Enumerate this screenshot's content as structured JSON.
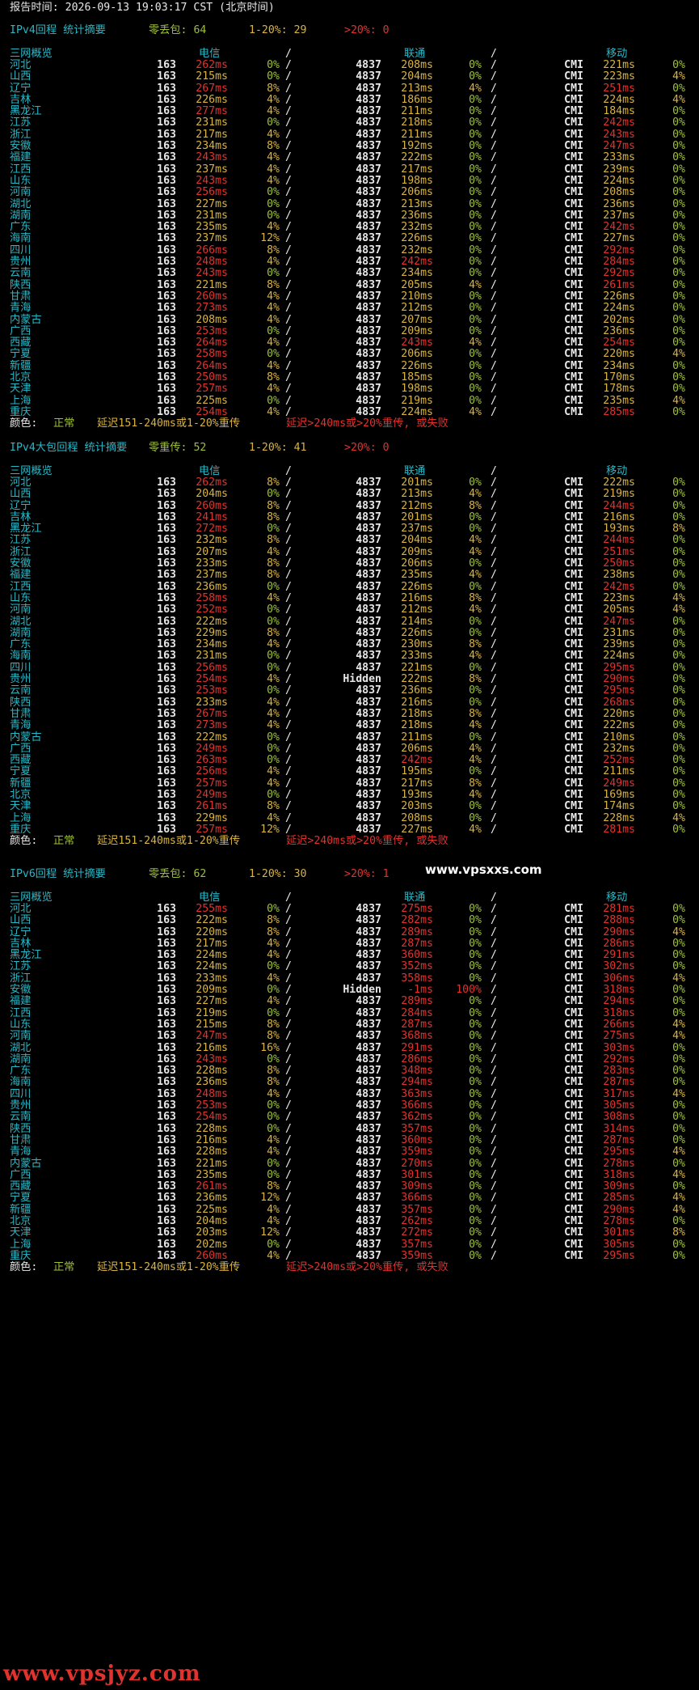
{
  "report_line": "报告时间: 2026-09-13 19:03:17 CST (北京时间)",
  "colors": {
    "ok": "#9fc03a",
    "warn": "#d9b441",
    "bad": "#e0332f",
    "cyan": "#29b7c6"
  },
  "legend": {
    "label": "颜色:",
    "ok": "正常",
    "warn": "延迟151-240ms或1-20%重传",
    "bad": "延迟>240ms或>20%重传, 或失败"
  },
  "columns": {
    "overview": "三网概览",
    "telecom": "电信",
    "unicom": "联通",
    "mobile": "移动"
  },
  "sections": [
    {
      "title": "IPv4回程 统计摘要",
      "summary": {
        "zero_label": "零丢包: 64",
        "mid_label": "1-20%: 29",
        "high_label": ">20%: 0"
      },
      "rows": [
        [
          "河北",
          "163",
          "262ms",
          "0%",
          "4837",
          "208ms",
          "0%",
          "CMI",
          "221ms",
          "0%"
        ],
        [
          "山西",
          "163",
          "215ms",
          "0%",
          "4837",
          "204ms",
          "0%",
          "CMI",
          "223ms",
          "4%"
        ],
        [
          "辽宁",
          "163",
          "267ms",
          "8%",
          "4837",
          "213ms",
          "4%",
          "CMI",
          "251ms",
          "0%"
        ],
        [
          "吉林",
          "163",
          "226ms",
          "4%",
          "4837",
          "186ms",
          "0%",
          "CMI",
          "224ms",
          "4%"
        ],
        [
          "黑龙江",
          "163",
          "277ms",
          "4%",
          "4837",
          "211ms",
          "0%",
          "CMI",
          "184ms",
          "0%"
        ],
        [
          "江苏",
          "163",
          "231ms",
          "0%",
          "4837",
          "218ms",
          "0%",
          "CMI",
          "242ms",
          "0%"
        ],
        [
          "浙江",
          "163",
          "217ms",
          "4%",
          "4837",
          "211ms",
          "0%",
          "CMI",
          "243ms",
          "0%"
        ],
        [
          "安徽",
          "163",
          "234ms",
          "8%",
          "4837",
          "192ms",
          "0%",
          "CMI",
          "247ms",
          "0%"
        ],
        [
          "福建",
          "163",
          "243ms",
          "4%",
          "4837",
          "222ms",
          "0%",
          "CMI",
          "233ms",
          "0%"
        ],
        [
          "江西",
          "163",
          "237ms",
          "4%",
          "4837",
          "217ms",
          "0%",
          "CMI",
          "239ms",
          "0%"
        ],
        [
          "山东",
          "163",
          "243ms",
          "4%",
          "4837",
          "198ms",
          "0%",
          "CMI",
          "224ms",
          "0%"
        ],
        [
          "河南",
          "163",
          "256ms",
          "0%",
          "4837",
          "206ms",
          "0%",
          "CMI",
          "208ms",
          "0%"
        ],
        [
          "湖北",
          "163",
          "227ms",
          "0%",
          "4837",
          "213ms",
          "0%",
          "CMI",
          "236ms",
          "0%"
        ],
        [
          "湖南",
          "163",
          "231ms",
          "0%",
          "4837",
          "236ms",
          "0%",
          "CMI",
          "237ms",
          "0%"
        ],
        [
          "广东",
          "163",
          "235ms",
          "4%",
          "4837",
          "232ms",
          "0%",
          "CMI",
          "242ms",
          "0%"
        ],
        [
          "海南",
          "163",
          "237ms",
          "12%",
          "4837",
          "226ms",
          "0%",
          "CMI",
          "227ms",
          "0%"
        ],
        [
          "四川",
          "163",
          "266ms",
          "8%",
          "4837",
          "232ms",
          "0%",
          "CMI",
          "292ms",
          "0%"
        ],
        [
          "贵州",
          "163",
          "248ms",
          "4%",
          "4837",
          "242ms",
          "0%",
          "CMI",
          "284ms",
          "0%"
        ],
        [
          "云南",
          "163",
          "243ms",
          "0%",
          "4837",
          "234ms",
          "0%",
          "CMI",
          "292ms",
          "0%"
        ],
        [
          "陕西",
          "163",
          "221ms",
          "8%",
          "4837",
          "205ms",
          "4%",
          "CMI",
          "261ms",
          "0%"
        ],
        [
          "甘肃",
          "163",
          "260ms",
          "4%",
          "4837",
          "210ms",
          "0%",
          "CMI",
          "226ms",
          "0%"
        ],
        [
          "青海",
          "163",
          "273ms",
          "4%",
          "4837",
          "212ms",
          "0%",
          "CMI",
          "224ms",
          "0%"
        ],
        [
          "内蒙古",
          "163",
          "208ms",
          "4%",
          "4837",
          "207ms",
          "0%",
          "CMI",
          "202ms",
          "0%"
        ],
        [
          "广西",
          "163",
          "253ms",
          "0%",
          "4837",
          "209ms",
          "0%",
          "CMI",
          "236ms",
          "0%"
        ],
        [
          "西藏",
          "163",
          "264ms",
          "4%",
          "4837",
          "243ms",
          "4%",
          "CMI",
          "254ms",
          "0%"
        ],
        [
          "宁夏",
          "163",
          "258ms",
          "0%",
          "4837",
          "206ms",
          "0%",
          "CMI",
          "220ms",
          "4%"
        ],
        [
          "新疆",
          "163",
          "264ms",
          "4%",
          "4837",
          "226ms",
          "0%",
          "CMI",
          "234ms",
          "0%"
        ],
        [
          "北京",
          "163",
          "250ms",
          "8%",
          "4837",
          "185ms",
          "0%",
          "CMI",
          "170ms",
          "0%"
        ],
        [
          "天津",
          "163",
          "257ms",
          "4%",
          "4837",
          "198ms",
          "0%",
          "CMI",
          "178ms",
          "0%"
        ],
        [
          "上海",
          "163",
          "225ms",
          "0%",
          "4837",
          "219ms",
          "0%",
          "CMI",
          "235ms",
          "4%"
        ],
        [
          "重庆",
          "163",
          "254ms",
          "4%",
          "4837",
          "224ms",
          "4%",
          "CMI",
          "285ms",
          "0%"
        ]
      ]
    },
    {
      "title": "IPv4大包回程 统计摘要",
      "summary": {
        "zero_label": "零重传: 52",
        "mid_label": "1-20%: 41",
        "high_label": ">20%: 0"
      },
      "rows": [
        [
          "河北",
          "163",
          "262ms",
          "8%",
          "4837",
          "201ms",
          "0%",
          "CMI",
          "222ms",
          "0%"
        ],
        [
          "山西",
          "163",
          "204ms",
          "0%",
          "4837",
          "213ms",
          "4%",
          "CMI",
          "219ms",
          "0%"
        ],
        [
          "辽宁",
          "163",
          "260ms",
          "8%",
          "4837",
          "212ms",
          "8%",
          "CMI",
          "244ms",
          "0%"
        ],
        [
          "吉林",
          "163",
          "241ms",
          "8%",
          "4837",
          "201ms",
          "0%",
          "CMI",
          "216ms",
          "0%"
        ],
        [
          "黑龙江",
          "163",
          "272ms",
          "0%",
          "4837",
          "237ms",
          "0%",
          "CMI",
          "193ms",
          "8%"
        ],
        [
          "江苏",
          "163",
          "232ms",
          "8%",
          "4837",
          "204ms",
          "4%",
          "CMI",
          "244ms",
          "0%"
        ],
        [
          "浙江",
          "163",
          "207ms",
          "4%",
          "4837",
          "209ms",
          "4%",
          "CMI",
          "251ms",
          "0%"
        ],
        [
          "安徽",
          "163",
          "233ms",
          "8%",
          "4837",
          "206ms",
          "0%",
          "CMI",
          "250ms",
          "0%"
        ],
        [
          "福建",
          "163",
          "237ms",
          "8%",
          "4837",
          "235ms",
          "4%",
          "CMI",
          "238ms",
          "0%"
        ],
        [
          "江西",
          "163",
          "236ms",
          "0%",
          "4837",
          "226ms",
          "0%",
          "CMI",
          "242ms",
          "0%"
        ],
        [
          "山东",
          "163",
          "258ms",
          "4%",
          "4837",
          "216ms",
          "8%",
          "CMI",
          "223ms",
          "4%"
        ],
        [
          "河南",
          "163",
          "252ms",
          "0%",
          "4837",
          "212ms",
          "4%",
          "CMI",
          "205ms",
          "4%"
        ],
        [
          "湖北",
          "163",
          "222ms",
          "0%",
          "4837",
          "214ms",
          "0%",
          "CMI",
          "247ms",
          "0%"
        ],
        [
          "湖南",
          "163",
          "229ms",
          "8%",
          "4837",
          "226ms",
          "0%",
          "CMI",
          "231ms",
          "0%"
        ],
        [
          "广东",
          "163",
          "234ms",
          "4%",
          "4837",
          "230ms",
          "8%",
          "CMI",
          "239ms",
          "0%"
        ],
        [
          "海南",
          "163",
          "231ms",
          "0%",
          "4837",
          "233ms",
          "4%",
          "CMI",
          "224ms",
          "0%"
        ],
        [
          "四川",
          "163",
          "256ms",
          "0%",
          "4837",
          "221ms",
          "0%",
          "CMI",
          "295ms",
          "0%"
        ],
        [
          "贵州",
          "163",
          "254ms",
          "4%",
          "Hidden",
          "222ms",
          "8%",
          "CMI",
          "290ms",
          "0%"
        ],
        [
          "云南",
          "163",
          "253ms",
          "0%",
          "4837",
          "236ms",
          "0%",
          "CMI",
          "295ms",
          "0%"
        ],
        [
          "陕西",
          "163",
          "233ms",
          "4%",
          "4837",
          "216ms",
          "0%",
          "CMI",
          "268ms",
          "0%"
        ],
        [
          "甘肃",
          "163",
          "267ms",
          "4%",
          "4837",
          "218ms",
          "8%",
          "CMI",
          "220ms",
          "0%"
        ],
        [
          "青海",
          "163",
          "273ms",
          "4%",
          "4837",
          "218ms",
          "4%",
          "CMI",
          "222ms",
          "0%"
        ],
        [
          "内蒙古",
          "163",
          "222ms",
          "0%",
          "4837",
          "211ms",
          "0%",
          "CMI",
          "210ms",
          "0%"
        ],
        [
          "广西",
          "163",
          "249ms",
          "0%",
          "4837",
          "206ms",
          "4%",
          "CMI",
          "232ms",
          "0%"
        ],
        [
          "西藏",
          "163",
          "263ms",
          "0%",
          "4837",
          "242ms",
          "4%",
          "CMI",
          "252ms",
          "0%"
        ],
        [
          "宁夏",
          "163",
          "256ms",
          "4%",
          "4837",
          "195ms",
          "0%",
          "CMI",
          "211ms",
          "0%"
        ],
        [
          "新疆",
          "163",
          "257ms",
          "4%",
          "4837",
          "217ms",
          "8%",
          "CMI",
          "249ms",
          "0%"
        ],
        [
          "北京",
          "163",
          "249ms",
          "0%",
          "4837",
          "193ms",
          "4%",
          "CMI",
          "169ms",
          "0%"
        ],
        [
          "天津",
          "163",
          "261ms",
          "8%",
          "4837",
          "203ms",
          "0%",
          "CMI",
          "174ms",
          "0%"
        ],
        [
          "上海",
          "163",
          "229ms",
          "4%",
          "4837",
          "208ms",
          "0%",
          "CMI",
          "228ms",
          "4%"
        ],
        [
          "重庆",
          "163",
          "257ms",
          "12%",
          "4837",
          "227ms",
          "4%",
          "CMI",
          "281ms",
          "0%"
        ]
      ]
    },
    {
      "title": "IPv6回程 统计摘要",
      "summary": {
        "zero_label": "零丢包: 62",
        "mid_label": "1-20%: 30",
        "high_label": ">20%: 1"
      },
      "rows": [
        [
          "河北",
          "163",
          "255ms",
          "0%",
          "4837",
          "275ms",
          "0%",
          "CMI",
          "281ms",
          "0%"
        ],
        [
          "山西",
          "163",
          "222ms",
          "8%",
          "4837",
          "282ms",
          "0%",
          "CMI",
          "288ms",
          "0%"
        ],
        [
          "辽宁",
          "163",
          "220ms",
          "8%",
          "4837",
          "289ms",
          "0%",
          "CMI",
          "290ms",
          "4%"
        ],
        [
          "吉林",
          "163",
          "217ms",
          "4%",
          "4837",
          "287ms",
          "0%",
          "CMI",
          "286ms",
          "0%"
        ],
        [
          "黑龙江",
          "163",
          "224ms",
          "4%",
          "4837",
          "360ms",
          "0%",
          "CMI",
          "291ms",
          "0%"
        ],
        [
          "江苏",
          "163",
          "224ms",
          "0%",
          "4837",
          "352ms",
          "0%",
          "CMI",
          "302ms",
          "0%"
        ],
        [
          "浙江",
          "163",
          "233ms",
          "4%",
          "4837",
          "358ms",
          "0%",
          "CMI",
          "306ms",
          "4%"
        ],
        [
          "安徽",
          "163",
          "209ms",
          "0%",
          "Hidden",
          "-1ms",
          "100%",
          "CMI",
          "318ms",
          "0%"
        ],
        [
          "福建",
          "163",
          "227ms",
          "4%",
          "4837",
          "289ms",
          "0%",
          "CMI",
          "294ms",
          "0%"
        ],
        [
          "江西",
          "163",
          "219ms",
          "0%",
          "4837",
          "284ms",
          "0%",
          "CMI",
          "318ms",
          "0%"
        ],
        [
          "山东",
          "163",
          "215ms",
          "8%",
          "4837",
          "287ms",
          "0%",
          "CMI",
          "266ms",
          "4%"
        ],
        [
          "河南",
          "163",
          "247ms",
          "8%",
          "4837",
          "368ms",
          "0%",
          "CMI",
          "275ms",
          "4%"
        ],
        [
          "湖北",
          "163",
          "216ms",
          "16%",
          "4837",
          "291ms",
          "0%",
          "CMI",
          "303ms",
          "0%"
        ],
        [
          "湖南",
          "163",
          "243ms",
          "0%",
          "4837",
          "286ms",
          "0%",
          "CMI",
          "292ms",
          "0%"
        ],
        [
          "广东",
          "163",
          "228ms",
          "8%",
          "4837",
          "348ms",
          "0%",
          "CMI",
          "283ms",
          "0%"
        ],
        [
          "海南",
          "163",
          "236ms",
          "8%",
          "4837",
          "294ms",
          "0%",
          "CMI",
          "287ms",
          "0%"
        ],
        [
          "四川",
          "163",
          "248ms",
          "4%",
          "4837",
          "363ms",
          "0%",
          "CMI",
          "317ms",
          "4%"
        ],
        [
          "贵州",
          "163",
          "253ms",
          "0%",
          "4837",
          "366ms",
          "0%",
          "CMI",
          "305ms",
          "0%"
        ],
        [
          "云南",
          "163",
          "254ms",
          "0%",
          "4837",
          "362ms",
          "0%",
          "CMI",
          "308ms",
          "0%"
        ],
        [
          "陕西",
          "163",
          "228ms",
          "0%",
          "4837",
          "357ms",
          "0%",
          "CMI",
          "314ms",
          "0%"
        ],
        [
          "甘肃",
          "163",
          "216ms",
          "4%",
          "4837",
          "360ms",
          "0%",
          "CMI",
          "287ms",
          "0%"
        ],
        [
          "青海",
          "163",
          "228ms",
          "4%",
          "4837",
          "359ms",
          "0%",
          "CMI",
          "295ms",
          "4%"
        ],
        [
          "内蒙古",
          "163",
          "221ms",
          "0%",
          "4837",
          "270ms",
          "0%",
          "CMI",
          "278ms",
          "0%"
        ],
        [
          "广西",
          "163",
          "235ms",
          "0%",
          "4837",
          "301ms",
          "0%",
          "CMI",
          "318ms",
          "4%"
        ],
        [
          "西藏",
          "163",
          "261ms",
          "8%",
          "4837",
          "309ms",
          "0%",
          "CMI",
          "309ms",
          "0%"
        ],
        [
          "宁夏",
          "163",
          "236ms",
          "12%",
          "4837",
          "366ms",
          "0%",
          "CMI",
          "285ms",
          "4%"
        ],
        [
          "新疆",
          "163",
          "225ms",
          "4%",
          "4837",
          "357ms",
          "0%",
          "CMI",
          "290ms",
          "4%"
        ],
        [
          "北京",
          "163",
          "204ms",
          "4%",
          "4837",
          "262ms",
          "0%",
          "CMI",
          "278ms",
          "0%"
        ],
        [
          "天津",
          "163",
          "203ms",
          "12%",
          "4837",
          "272ms",
          "0%",
          "CMI",
          "301ms",
          "8%"
        ],
        [
          "上海",
          "163",
          "202ms",
          "0%",
          "4837",
          "357ms",
          "0%",
          "CMI",
          "305ms",
          "0%"
        ],
        [
          "重庆",
          "163",
          "260ms",
          "4%",
          "4837",
          "359ms",
          "0%",
          "CMI",
          "295ms",
          "0%"
        ]
      ]
    }
  ],
  "watermarks": {
    "site_top": "www.vpsxxs.com",
    "site_bottom": "www.vpsjyz.com"
  }
}
